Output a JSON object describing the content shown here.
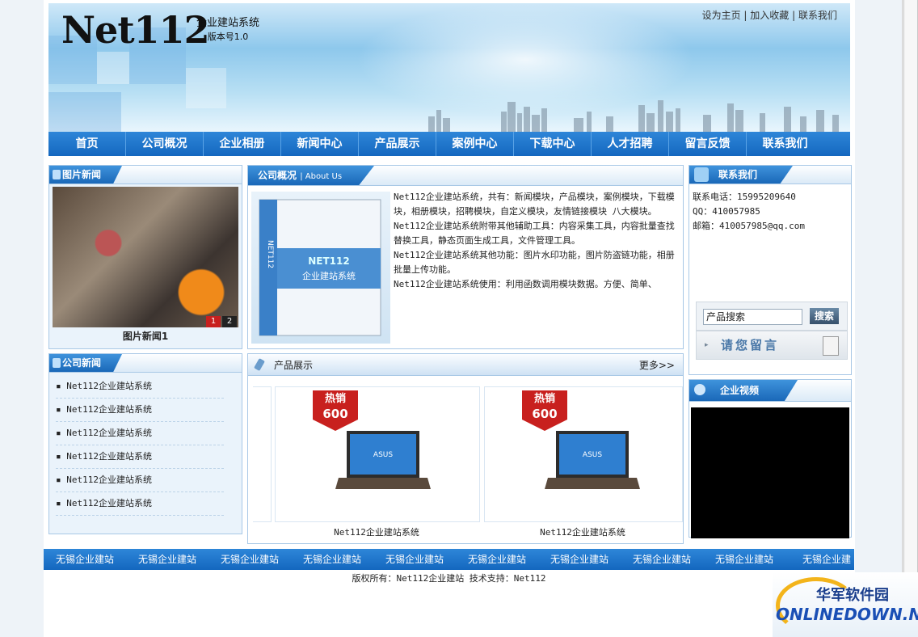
{
  "site": {
    "logo": "Net112",
    "logo_sub1": "企业建站系统",
    "logo_sub2": "版本号1.0",
    "top_links": [
      "设为主页",
      "加入收藏",
      "联系我们"
    ]
  },
  "nav": [
    "首页",
    "公司概况",
    "企业相册",
    "新闻中心",
    "产品展示",
    "案例中心",
    "下载中心",
    "人才招聘",
    "留言反馈",
    "联系我们"
  ],
  "photo_news": {
    "title": "图片新闻",
    "pages": [
      "1",
      "2"
    ],
    "caption": "图片新闻1"
  },
  "company_news": {
    "title": "公司新闻",
    "items": [
      "Net112企业建站系统",
      "Net112企业建站系统",
      "Net112企业建站系统",
      "Net112企业建站系统",
      "Net112企业建站系统",
      "Net112企业建站系统"
    ]
  },
  "about": {
    "title": "公司概况",
    "subtitle": "| About Us",
    "box_brand": "NET112",
    "box_title": "企业建站系统",
    "paragraphs": [
      "Net112企业建站系统，共有：新闻模块，产品模块，案例模块，下载模块，相册模块，招聘模块，自定义模块，友情链接模块 八大模块。",
      "Net112企业建站系统附带其他辅助工具：内容采集工具，内容批量查找替换工具，静态页面生成工具，文件管理工具。",
      "Net112企业建站系统其他功能：图片水印功能，图片防盗链功能，相册批量上传功能。",
      "Net112企业建站系统使用：利用函数调用模块数据。方便、简单、"
    ]
  },
  "products": {
    "title": "产品展示",
    "more": "更多>>",
    "items": [
      {
        "badge_top": "热销",
        "badge_num": "600",
        "brand": "ASUS",
        "name": "Net112企业建站系统"
      },
      {
        "badge_top": "热销",
        "badge_num": "600",
        "brand": "ASUS",
        "name": "Net112企业建站系统"
      }
    ]
  },
  "contact": {
    "title": "联系我们",
    "phone": "联系电话：15995209640",
    "qq": "QQ：410057985",
    "email": "邮箱：410057985@qq.com",
    "search_placeholder": "产品搜索",
    "search_button": "搜索",
    "message_label": "请您留言"
  },
  "video": {
    "title": "企业视频"
  },
  "marquee": [
    "无锡企业建站",
    "无锡企业建站",
    "无锡企业建站",
    "无锡企业建站",
    "无锡企业建站",
    "无锡企业建站",
    "无锡企业建站",
    "无锡企业建站",
    "无锡企业建站",
    "无锡企业建"
  ],
  "footer": {
    "copyright": "版权所有：Net112企业建站 技术支持：Net112"
  },
  "watermark": {
    "cn": "华军软件园",
    "en": "ONLINEDOWN.NET"
  }
}
